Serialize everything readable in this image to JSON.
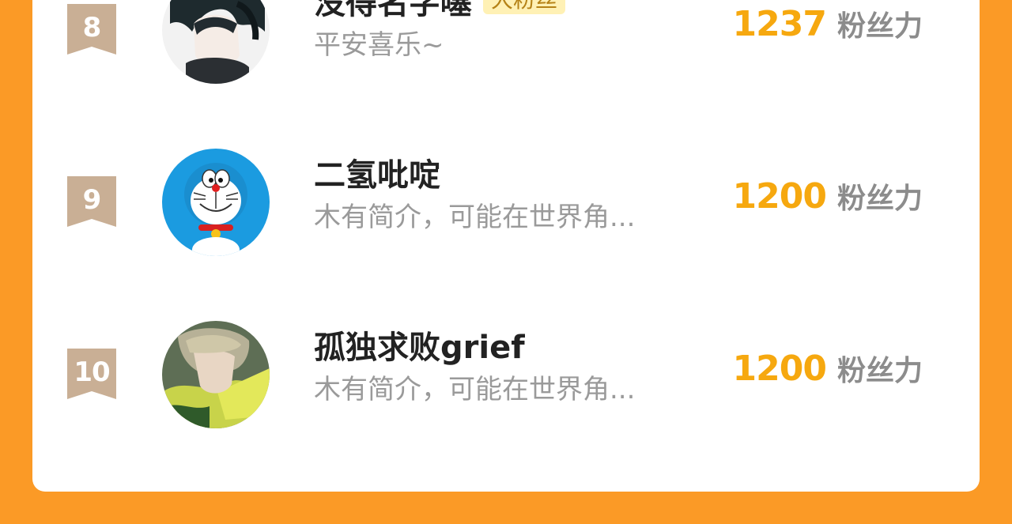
{
  "leaderboard": {
    "rows": [
      {
        "rank": "8",
        "name": "没得名字噻",
        "tag": "大粉丝",
        "bio": "平安喜乐~",
        "score": "1237",
        "score_unit": "粉丝力",
        "avatar": "anime-dark-hair-avatar"
      },
      {
        "rank": "9",
        "name": "二氢吡啶",
        "bio": "木有简介，可能在世界角...",
        "score": "1200",
        "score_unit": "粉丝力",
        "avatar": "doraemon-avatar"
      },
      {
        "rank": "10",
        "name": "孤独求败grief",
        "bio": "木有简介，可能在世界角...",
        "score": "1200",
        "score_unit": "粉丝力",
        "avatar": "anime-green-hair-avatar"
      }
    ]
  },
  "colors": {
    "page_background": "#FB9A26",
    "panel": "#FFFFFF",
    "rank_badge": "#C9AF95",
    "score": "#F6A80F",
    "tag_background": "#FFF1B5",
    "tag_text": "#B58216"
  }
}
